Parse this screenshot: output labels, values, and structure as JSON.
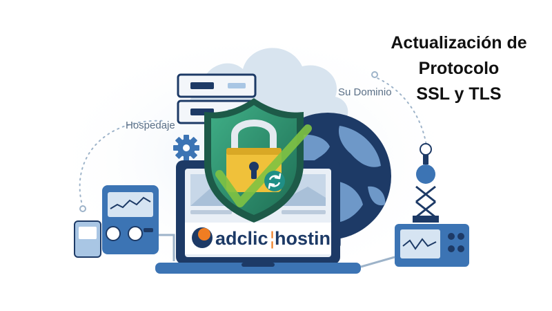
{
  "headline": {
    "line1": "Actualización de",
    "line2": "Protocolo",
    "line3": "SSL y TLS"
  },
  "labels": {
    "hosting": "Hospedaje",
    "domain": "Su Dominio"
  },
  "logo": {
    "part1": "adclic",
    "part2": "hosting"
  },
  "icons": [
    "cloud-icon",
    "server-icon",
    "shield-icon",
    "padlock-icon",
    "checkmark-icon",
    "refresh-icon",
    "globe-icon",
    "gear-icon",
    "laptop-icon",
    "device-icon",
    "antenna-icon"
  ],
  "colors": {
    "navy": "#1d3a66",
    "blue": "#3c74b4",
    "light_blue": "#a9c6e4",
    "cloud": "#d8e4ef",
    "shield_green": "#2f8f6e",
    "lock_yellow": "#f0c13a",
    "check_green": "#7fc242",
    "logo_orange": "#ef7d22"
  }
}
